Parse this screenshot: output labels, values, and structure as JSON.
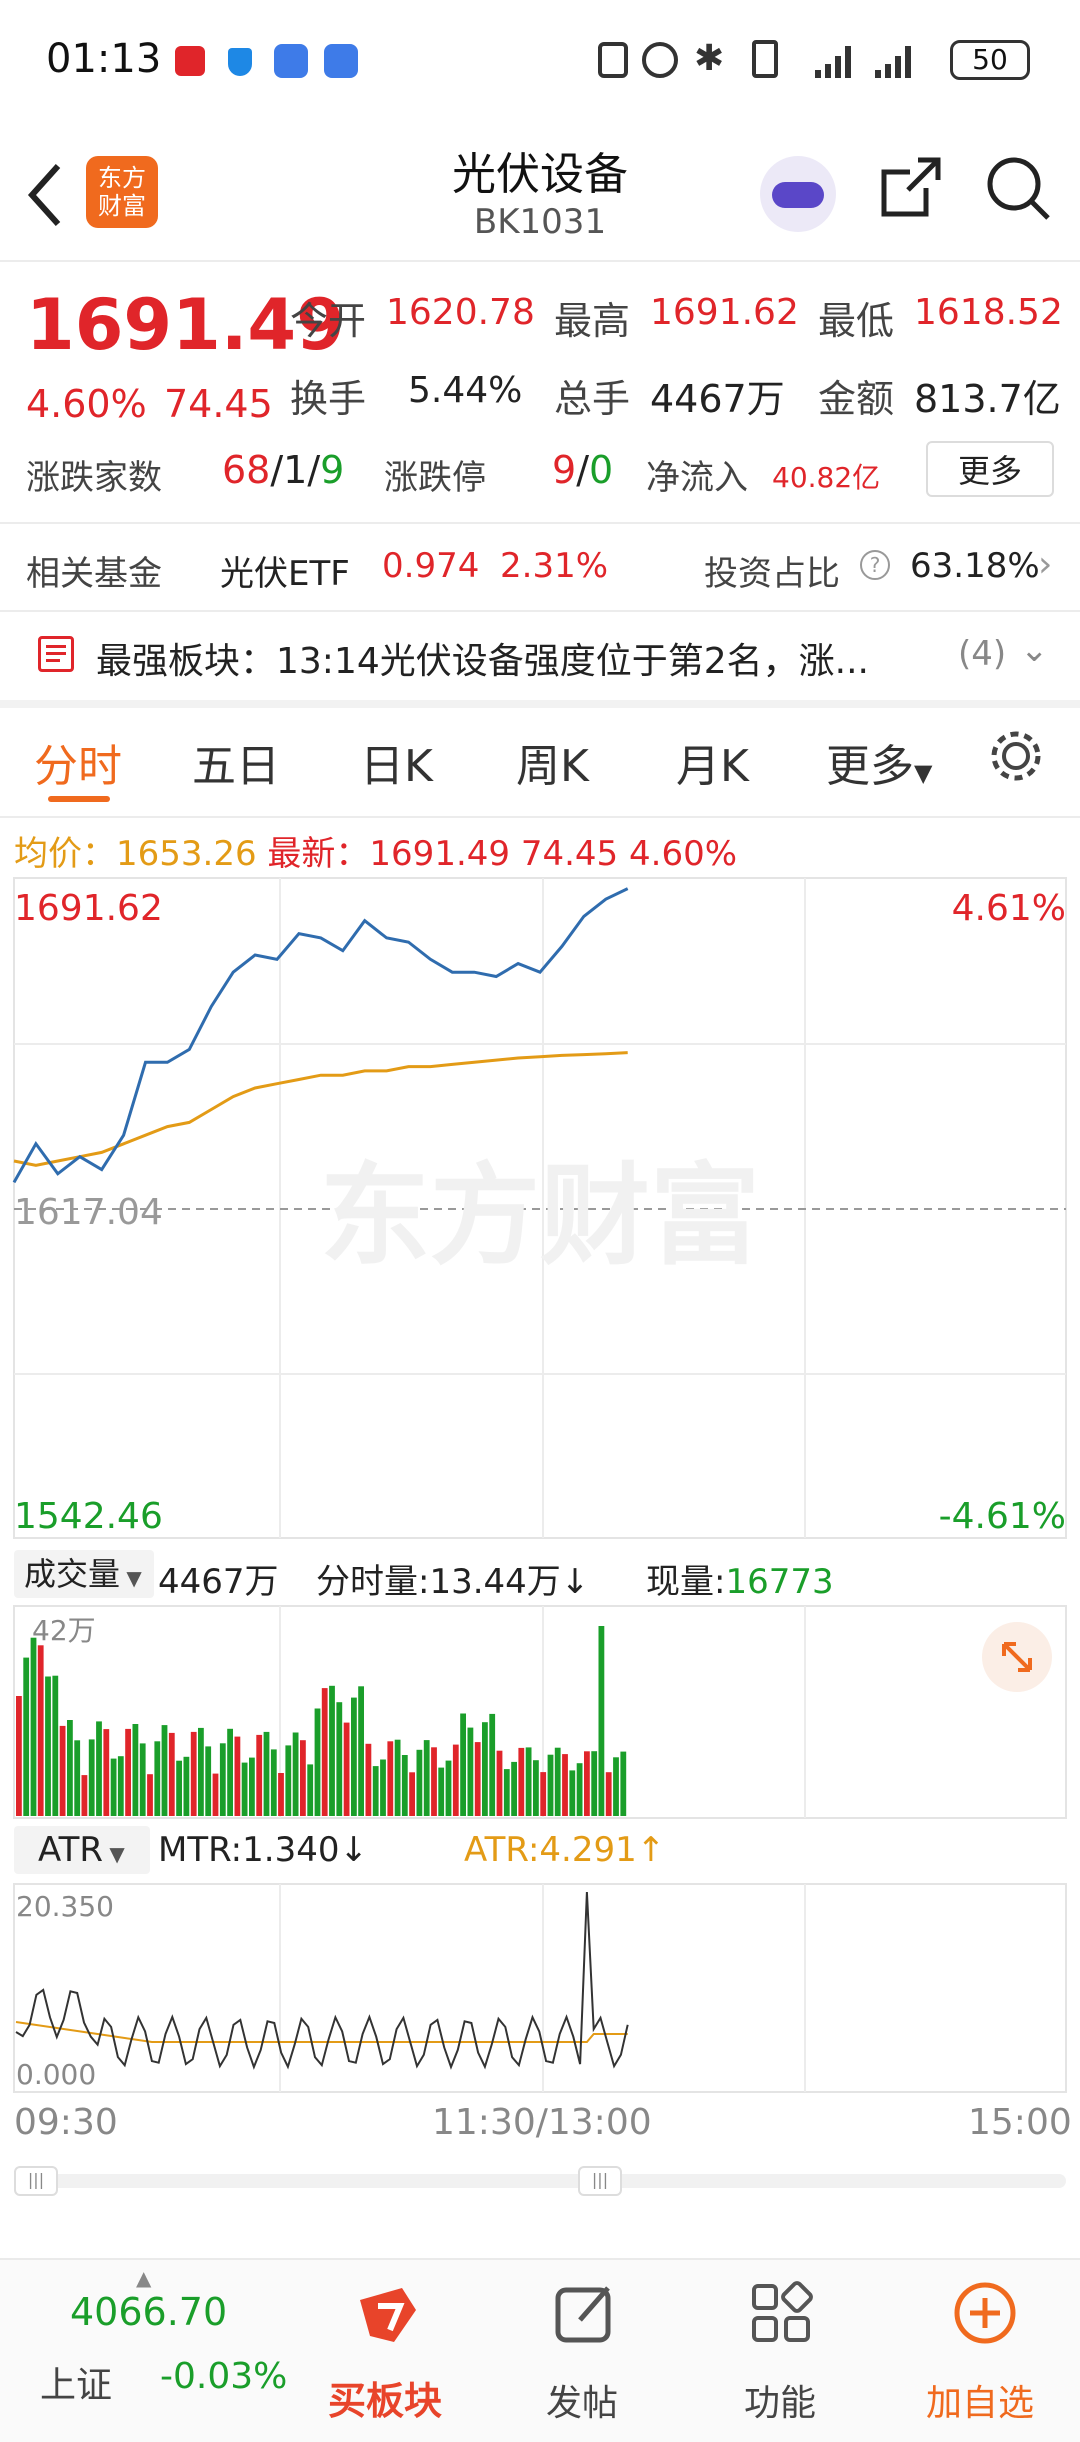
{
  "status_bar": {
    "time": "01:13",
    "battery": "50"
  },
  "header": {
    "title": "光伏设备",
    "code": "BK1031",
    "logo_line1": "东方",
    "logo_line2": "财富"
  },
  "quote": {
    "price": "1691.49",
    "change_pct": "4.60%",
    "change": "74.45",
    "open_label": "今开",
    "open": "1620.78",
    "high_label": "最高",
    "high": "1691.62",
    "low_label": "最低",
    "low": "1618.52",
    "turnover_label": "换手",
    "turnover": "5.44%",
    "volume_label": "总手",
    "volume": "4467万",
    "amount_label": "金额",
    "amount": "813.7亿",
    "updown_label": "涨跌家数",
    "up": "68",
    "flat": "1",
    "down": "9",
    "limit_label": "涨跌停",
    "limit_up": "9",
    "limit_down": "0",
    "netflow_label": "净流入",
    "netflow": "40.82亿",
    "more_button": "更多"
  },
  "fund": {
    "label": "相关基金",
    "name": "光伏ETF",
    "price": "0.974",
    "pct": "2.31%",
    "ratio_label": "投资占比",
    "ratio": "63.18%"
  },
  "news": {
    "text": "最强板块：13:14光伏设备强度位于第2名，涨...",
    "count": "(4)"
  },
  "tabs": [
    "分时",
    "五日",
    "日K",
    "周K",
    "月K",
    "更多"
  ],
  "info_line": {
    "avg_label": "均价：",
    "avg": "1653.26",
    "last_label": "最新：",
    "last": "1691.49",
    "change": "74.45",
    "pct": "4.60%"
  },
  "chart_labels": {
    "top_left": "1691.62",
    "top_right": "4.61%",
    "mid_left": "1617.04",
    "bottom_left": "1542.46",
    "bottom_right": "-4.61%",
    "watermark": "东方财富"
  },
  "volume_bar": {
    "select": "成交量",
    "total": "4467万",
    "period_label": "分时量:",
    "period": "13.44万",
    "period_arrow": "↓",
    "now_label": "现量:",
    "now": "16773",
    "scale": "42万"
  },
  "atr_bar": {
    "select": "ATR",
    "mtr_label": "MTR:",
    "mtr": "1.340",
    "mtr_arrow": "↓",
    "atr_label": "ATR:",
    "atr": "4.291",
    "atr_arrow": "↑",
    "top": "20.350",
    "bottom": "0.000"
  },
  "time_axis": [
    "09:30",
    "11:30/13:00",
    "15:00"
  ],
  "bottom_nav": {
    "index_value": "4066.70",
    "index_name": "上证",
    "index_change": "-0.03%",
    "buy_label": "买板块",
    "post_label": "发帖",
    "func_label": "功能",
    "add_label": "加自选"
  },
  "chart_data": {
    "type": "line",
    "title": "",
    "ylim": [
      1542.46,
      1691.62
    ],
    "prev_close": 1617.04,
    "x_session_minutes": [
      0,
      5,
      10,
      15,
      20,
      25,
      30,
      35,
      40,
      45,
      50,
      55,
      60,
      65,
      70,
      75,
      80,
      85,
      90,
      95,
      100,
      105,
      110,
      115,
      120,
      125,
      130,
      135,
      140
    ],
    "series": [
      {
        "values": [
          1623,
          1632,
          1625,
          1629,
          1626,
          1634,
          1651,
          1651,
          1654,
          1664,
          1672,
          1676,
          1675,
          1681,
          1680,
          1677,
          1684,
          1680,
          1679,
          1675,
          1672,
          1672,
          1671,
          1674,
          1672,
          1678,
          1685,
          1689,
          1691.49
        ],
        "color": "#2f6cae"
      },
      {
        "values": [
          1628,
          1627,
          1628,
          1629,
          1630,
          1632,
          1634,
          1636,
          1637,
          1640,
          1643,
          1645,
          1646,
          1647,
          1648,
          1648,
          1649,
          1649,
          1650,
          1650,
          1650.5,
          1651,
          1651.5,
          1652,
          1652.3,
          1652.6,
          1652.8,
          1653,
          1653.26
        ],
        "color": "#e39b16"
      }
    ]
  }
}
